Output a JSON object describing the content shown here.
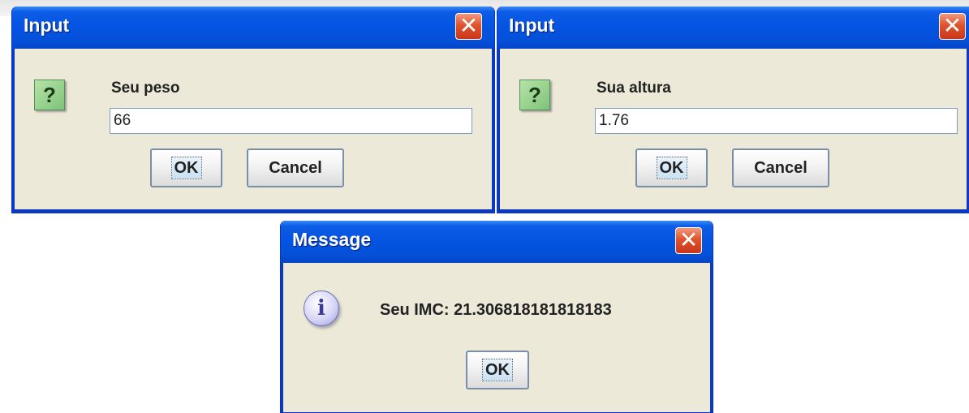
{
  "dialogs": {
    "weight": {
      "title": "Input",
      "close_symbol": "✕",
      "icon": "question-icon",
      "icon_glyph": "?",
      "prompt": "Seu peso",
      "input_value": "66",
      "ok_label": "OK",
      "cancel_label": "Cancel"
    },
    "height": {
      "title": "Input",
      "close_symbol": "✕",
      "icon": "question-icon",
      "icon_glyph": "?",
      "prompt": "Sua altura",
      "input_value": "1.76",
      "ok_label": "OK",
      "cancel_label": "Cancel"
    },
    "message": {
      "title": "Message",
      "close_symbol": "✕",
      "icon": "information-icon",
      "icon_glyph": "i",
      "text": "Seu IMC: 21.306818181818183",
      "ok_label": "OK"
    }
  },
  "colors": {
    "titlebar": "#0553e2",
    "dialog_background": "#ece9d8",
    "close_button": "#e0532d"
  }
}
